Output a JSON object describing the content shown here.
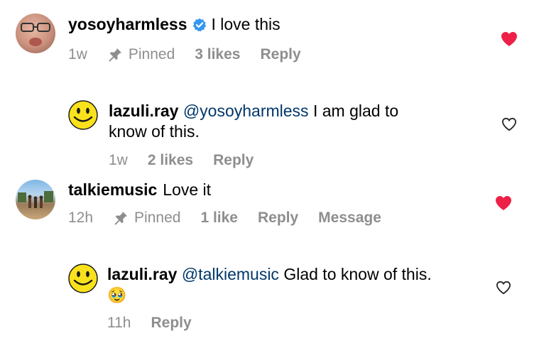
{
  "comments": [
    {
      "username": "yosoyharmless",
      "verified": true,
      "text": "I love this",
      "time": "1w",
      "pinned_label": "Pinned",
      "likes": "3 likes",
      "reply_label": "Reply",
      "liked": true
    },
    {
      "username": "lazuli.ray",
      "mention": "@yosoyharmless",
      "text_line1": "I am glad to",
      "text_line2": "know of this.",
      "time": "1w",
      "likes": "2 likes",
      "reply_label": "Reply",
      "liked": false
    },
    {
      "username": "talkiemusic",
      "text": "Love it",
      "time": "12h",
      "pinned_label": "Pinned",
      "likes": "1 like",
      "reply_label": "Reply",
      "message_label": "Message",
      "liked": true
    },
    {
      "username": "lazuli.ray",
      "mention": "@talkiemusic",
      "text": "Glad to know of this.",
      "emoji": "🥹",
      "time": "11h",
      "reply_label": "Reply",
      "liked": false
    }
  ],
  "colors": {
    "liked_heart": "#ed2147",
    "meta_gray": "#8e8e8e",
    "mention_blue": "#00376b",
    "verified_blue": "#3797f0"
  },
  "icons": [
    "verified-badge-icon",
    "pin-icon",
    "heart-filled-icon",
    "heart-outline-icon",
    "smiley-avatar-icon"
  ]
}
